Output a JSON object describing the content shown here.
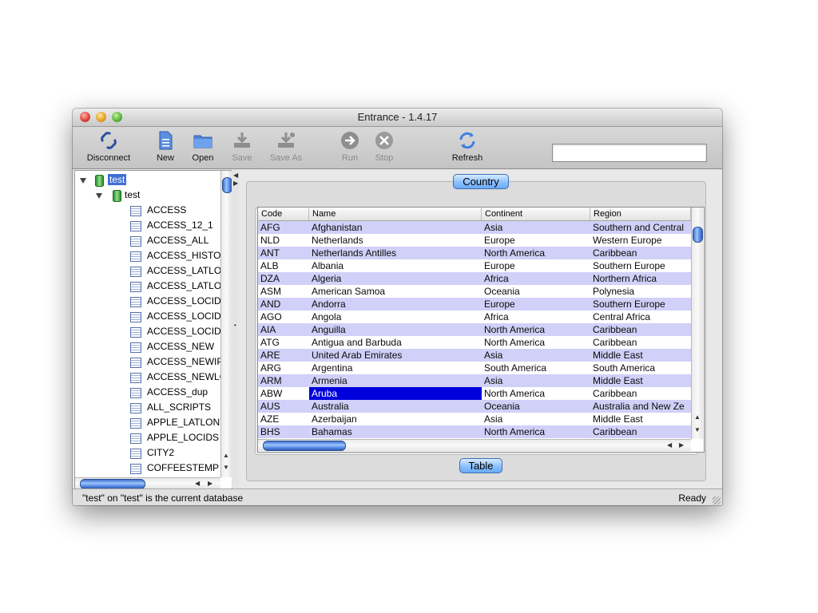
{
  "window": {
    "title": "Entrance - 1.4.17"
  },
  "toolbar": {
    "buttons": [
      {
        "label": "Disconnect",
        "icon": "disconnect-icon",
        "enabled": true
      },
      {
        "label": "New",
        "icon": "new-document-icon",
        "enabled": true
      },
      {
        "label": "Open",
        "icon": "folder-icon",
        "enabled": true
      },
      {
        "label": "Save",
        "icon": "save-icon",
        "enabled": false
      },
      {
        "label": "Save As",
        "icon": "save-as-icon",
        "enabled": false
      },
      {
        "label": "Run",
        "icon": "run-icon",
        "enabled": false
      },
      {
        "label": "Stop",
        "icon": "stop-icon",
        "enabled": false
      },
      {
        "label": "Refresh",
        "icon": "refresh-icon",
        "enabled": true
      }
    ],
    "search": {
      "value": ""
    }
  },
  "tree": {
    "root": "test",
    "schema": "test",
    "tables": [
      "ACCESS",
      "ACCESS_12_1",
      "ACCESS_ALL",
      "ACCESS_HISTOR",
      "ACCESS_LATLON",
      "ACCESS_LATLON",
      "ACCESS_LOCIDS",
      "ACCESS_LOCIDS",
      "ACCESS_LOCIDS",
      "ACCESS_NEW",
      "ACCESS_NEWIPS",
      "ACCESS_NEWLO",
      "ACCESS_dup",
      "ALL_SCRIPTS",
      "APPLE_LATLON",
      "APPLE_LOCIDS",
      "CITY2",
      "COFFEESTEMP"
    ]
  },
  "panel": {
    "title": "Country",
    "bottom_button": "Table"
  },
  "table": {
    "columns": [
      "Code",
      "Name",
      "Continent",
      "Region"
    ],
    "rows": [
      [
        "AFG",
        "Afghanistan",
        "Asia",
        "Southern and Central"
      ],
      [
        "NLD",
        "Netherlands",
        "Europe",
        "Western Europe"
      ],
      [
        "ANT",
        "Netherlands Antilles",
        "North America",
        "Caribbean"
      ],
      [
        "ALB",
        "Albania",
        "Europe",
        "Southern Europe"
      ],
      [
        "DZA",
        "Algeria",
        "Africa",
        "Northern Africa"
      ],
      [
        "ASM",
        "American Samoa",
        "Oceania",
        "Polynesia"
      ],
      [
        "AND",
        "Andorra",
        "Europe",
        "Southern Europe"
      ],
      [
        "AGO",
        "Angola",
        "Africa",
        "Central Africa"
      ],
      [
        "AIA",
        "Anguilla",
        "North America",
        "Caribbean"
      ],
      [
        "ATG",
        "Antigua and Barbuda",
        "North America",
        "Caribbean"
      ],
      [
        "ARE",
        "United Arab Emirates",
        "Asia",
        "Middle East"
      ],
      [
        "ARG",
        "Argentina",
        "South America",
        "South America"
      ],
      [
        "ARM",
        "Armenia",
        "Asia",
        "Middle East"
      ],
      [
        "ABW",
        "Aruba",
        "North America",
        "Caribbean"
      ],
      [
        "AUS",
        "Australia",
        "Oceania",
        "Australia and New Ze"
      ],
      [
        "AZE",
        "Azerbaijan",
        "Asia",
        "Middle East"
      ],
      [
        "BHS",
        "Bahamas",
        "North America",
        "Caribbean"
      ]
    ],
    "selected_row": 13
  },
  "status": {
    "message": "\"test\" on \"test\" is the current database",
    "state": "Ready"
  },
  "colors": {
    "alt_row": "#d0d0f8",
    "selection": "#0000dd",
    "accent": "#6aa9f4"
  }
}
